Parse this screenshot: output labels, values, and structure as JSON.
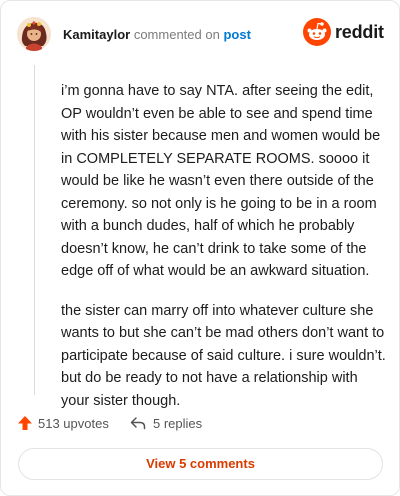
{
  "comment": {
    "author": "Kamitaylor",
    "action_text": "commented on",
    "post_link_label": "post",
    "body_paragraphs": [
      "i’m gonna have to say NTA. after seeing the edit, OP wouldn’t even be able to see and spend time with his sister because men and women would be in COMPLETELY SEPARATE ROOMS. soooo it would be like he wasn’t even there outside of the ceremony. so not only is he going to be in a room with a bunch dudes, half of which he probably doesn’t know, he can’t drink to take some of the edge off of what would be an awkward situation.",
      "the sister can marry off into whatever culture she wants to but she can’t be mad others don’t want to participate because of said culture. i sure wouldn’t. but do be ready to not have a relationship with your sister though."
    ],
    "upvotes_label": "513 upvotes",
    "replies_label": "5 replies",
    "view_comments_label": "View 5 comments"
  },
  "brand": {
    "logo_text": "reddit",
    "accent_color": "#ff4500",
    "link_color": "#0079d3"
  },
  "icons": {
    "avatar": "user-avatar",
    "logo": "reddit-alien-icon",
    "upvote": "upvote-arrow-icon",
    "reply": "reply-arrow-icon"
  }
}
